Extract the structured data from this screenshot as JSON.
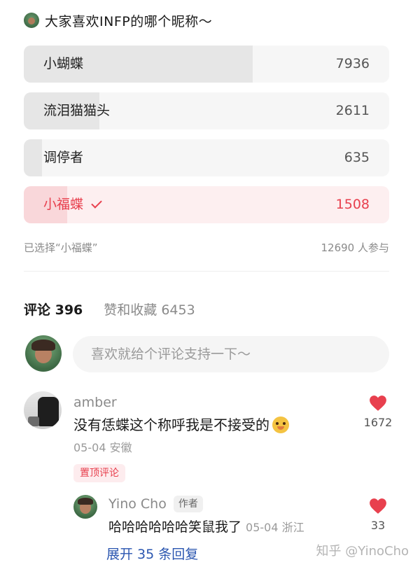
{
  "poll": {
    "question": "大家喜欢INFP的哪个昵称～",
    "options": [
      {
        "label": "小蝴蝶",
        "count": "7936",
        "share": 0.626
      },
      {
        "label": "流泪猫猫头",
        "count": "2611",
        "share": 0.206
      },
      {
        "label": "调停者",
        "count": "635",
        "share": 0.05
      },
      {
        "label": "小福蝶",
        "count": "1508",
        "share": 0.119,
        "selected": true
      }
    ],
    "selected_text": "已选择“小福蝶”",
    "participants": "12690 人参与",
    "accent_color": "#e8404e"
  },
  "comments_header": {
    "comments_tab": "评论 396",
    "likes_tab": "赞和收藏 6453"
  },
  "compose": {
    "placeholder": "喜欢就给个评论支持一下～"
  },
  "comment": {
    "author": "amber",
    "text": "没有恁蝶这个称呼我是不接受的",
    "meta": "05-04 安徽",
    "pinned_label": "置顶评论",
    "likes": "1672"
  },
  "reply": {
    "author": "Yino Cho",
    "author_badge": "作者",
    "text": "哈哈哈哈哈哈笑鼠我了",
    "meta": "05-04 浙江",
    "likes": "33"
  },
  "expand_replies": "展开 35 条回复",
  "watermark": "知乎 @YinoCho"
}
